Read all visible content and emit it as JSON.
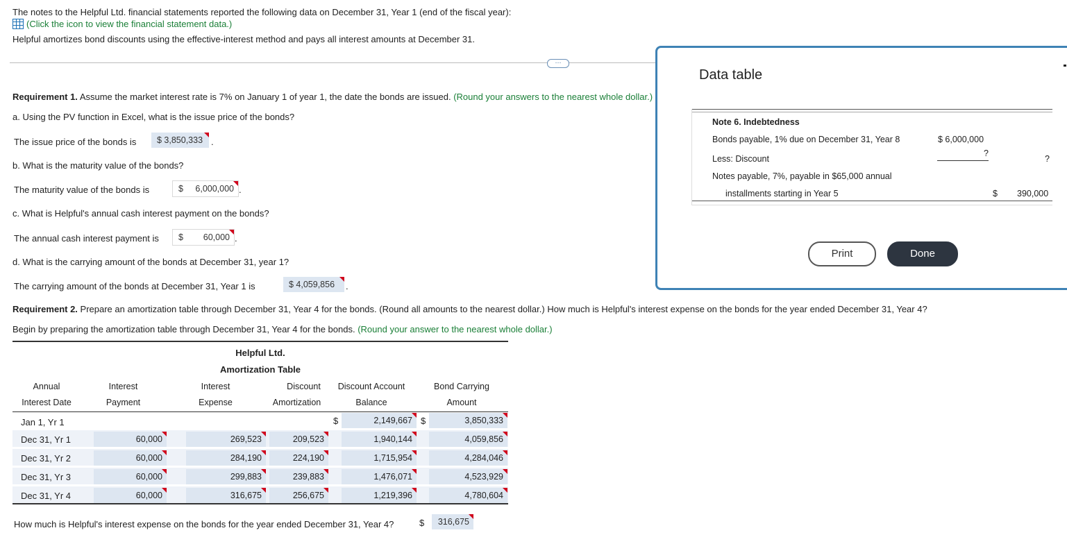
{
  "intro": {
    "line1": "The notes to the Helpful Ltd. financial statements reported the following data on December 31, Year 1 (end of the fiscal year):",
    "link": "(Click the icon to view the financial statement data.)",
    "line3": "Helpful amortizes bond discounts using the effective-interest method and pays all interest amounts at December 31.",
    "more_button": "⋯"
  },
  "req1": {
    "label": "Requirement 1.",
    "text": " Assume the market interest rate is 7% on January 1 of year 1, the date the bonds are issued.",
    "hint": "(Round your answers to the nearest whole dollar.)",
    "a_q": "a. Using the PV function in Excel, what is the issue price of the bonds?",
    "a_text": "The issue price of the bonds is",
    "a_val": "$ 3,850,333",
    "b_q": "b. What is the maturity value of the bonds?",
    "b_text": "The maturity value of the bonds is",
    "b_dollar": "$",
    "b_val": "6,000,000",
    "c_q": "c. What is Helpful's annual cash interest payment on the bonds?",
    "c_text": "The annual cash interest payment is",
    "c_dollar": "$",
    "c_val": "60,000",
    "d_q": "d. What is the carrying amount of the bonds at December 31, year 1?",
    "d_text": "The carrying amount of the bonds at December 31, Year 1 is",
    "d_val": "$ 4,059,856",
    "period": "."
  },
  "req2": {
    "label": "Requirement 2.",
    "text": " Prepare an amortization table through December 31, Year 4 for the bonds. (Round all amounts to the nearest dollar.) How much is Helpful's interest expense on the bonds for the year ended December 31, Year 4?",
    "begin": "Begin by preparing the amortization table through December 31, Year 4 for the bonds.",
    "begin_hint": "(Round your answer to the nearest whole dollar.)"
  },
  "table": {
    "title1": "Helpful Ltd.",
    "title2": "Amortization Table",
    "headers": [
      [
        "Annual",
        "Interest Date"
      ],
      [
        "Interest",
        "Payment"
      ],
      [
        "Interest",
        "Expense"
      ],
      [
        "Discount",
        "Amortization"
      ],
      [
        "Discount Account",
        "Balance"
      ],
      [
        "Bond Carrying",
        "Amount"
      ]
    ],
    "first_row": {
      "date": "Jan 1, Yr 1",
      "dollar1": "$",
      "balance": "2,149,667",
      "dollar2": "$",
      "carrying": "3,850,333"
    },
    "rows": [
      {
        "date": "Dec 31, Yr 1",
        "payment": "60,000",
        "expense": "269,523",
        "amort": "209,523",
        "balance": "1,940,144",
        "carrying": "4,059,856"
      },
      {
        "date": "Dec 31, Yr 2",
        "payment": "60,000",
        "expense": "284,190",
        "amort": "224,190",
        "balance": "1,715,954",
        "carrying": "4,284,046"
      },
      {
        "date": "Dec 31, Yr 3",
        "payment": "60,000",
        "expense": "299,883",
        "amort": "239,883",
        "balance": "1,476,071",
        "carrying": "4,523,929"
      },
      {
        "date": "Dec 31, Yr 4",
        "payment": "60,000",
        "expense": "316,675",
        "amort": "256,675",
        "balance": "1,219,396",
        "carrying": "4,780,604"
      }
    ]
  },
  "final": {
    "question": "How much is Helpful's interest expense on the bonds for the year ended December 31, Year 4?",
    "dollar": "$",
    "value": "316,675"
  },
  "data_table": {
    "title": "Data table",
    "note": "Note 6. Indebtedness",
    "r1_label": "Bonds payable, 1% due on December 31, Year 8",
    "r1_val": "$ 6,000,000",
    "r2_label": "Less: Discount",
    "r2_val": "?",
    "r2_total": "?",
    "r3_label": "Notes payable, 7%, payable in $65,000 annual",
    "r4_label": "installments starting in Year 5",
    "r4_dollar": "$",
    "r4_val": "390,000",
    "print": "Print",
    "done": "Done"
  }
}
